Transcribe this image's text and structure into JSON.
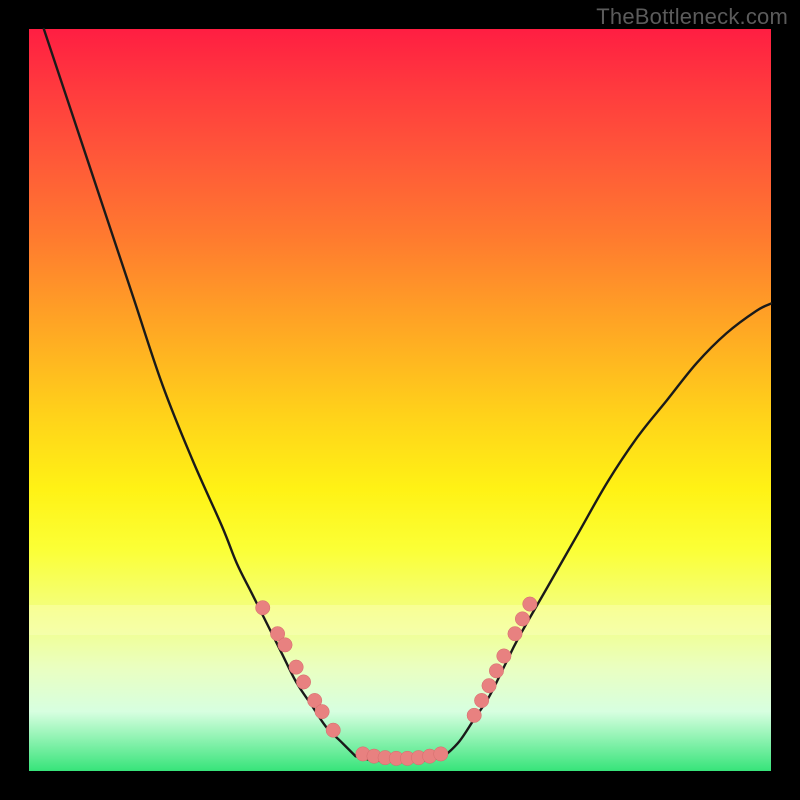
{
  "watermark": "TheBottleneck.com",
  "colors": {
    "curve_stroke": "#1a1a1a",
    "marker_fill": "#e88180",
    "marker_stroke": "#d46c6c",
    "background": "#000000"
  },
  "chart_data": {
    "type": "line",
    "title": "",
    "xlabel": "",
    "ylabel": "",
    "xlim": [
      0,
      100
    ],
    "ylim": [
      0,
      100
    ],
    "grid": false,
    "series": [
      {
        "name": "left-curve",
        "x": [
          2,
          6,
          10,
          14,
          18,
          22,
          26,
          28,
          30,
          32,
          34,
          36,
          38,
          40,
          42,
          44
        ],
        "values": [
          100,
          88,
          76,
          64,
          52,
          42,
          33,
          28,
          24,
          20,
          16,
          12,
          9,
          6,
          4,
          2
        ]
      },
      {
        "name": "flat-min",
        "x": [
          44,
          46,
          48,
          50,
          52,
          54,
          56
        ],
        "values": [
          2,
          1.5,
          1.3,
          1.2,
          1.3,
          1.5,
          2
        ]
      },
      {
        "name": "right-curve",
        "x": [
          56,
          58,
          60,
          62,
          64,
          66,
          70,
          74,
          78,
          82,
          86,
          90,
          94,
          98,
          100
        ],
        "values": [
          2,
          4,
          7,
          10,
          14,
          18,
          25,
          32,
          39,
          45,
          50,
          55,
          59,
          62,
          63
        ]
      }
    ],
    "markers": [
      {
        "x": 31.5,
        "y": 22
      },
      {
        "x": 33.5,
        "y": 18.5
      },
      {
        "x": 34.5,
        "y": 17
      },
      {
        "x": 36,
        "y": 14
      },
      {
        "x": 37,
        "y": 12
      },
      {
        "x": 38.5,
        "y": 9.5
      },
      {
        "x": 39.5,
        "y": 8
      },
      {
        "x": 41,
        "y": 5.5
      },
      {
        "x": 45,
        "y": 2.3
      },
      {
        "x": 46.5,
        "y": 2.0
      },
      {
        "x": 48,
        "y": 1.8
      },
      {
        "x": 49.5,
        "y": 1.7
      },
      {
        "x": 51,
        "y": 1.7
      },
      {
        "x": 52.5,
        "y": 1.8
      },
      {
        "x": 54,
        "y": 2.0
      },
      {
        "x": 55.5,
        "y": 2.3
      },
      {
        "x": 60,
        "y": 7.5
      },
      {
        "x": 61,
        "y": 9.5
      },
      {
        "x": 62,
        "y": 11.5
      },
      {
        "x": 63,
        "y": 13.5
      },
      {
        "x": 64,
        "y": 15.5
      },
      {
        "x": 65.5,
        "y": 18.5
      },
      {
        "x": 66.5,
        "y": 20.5
      },
      {
        "x": 67.5,
        "y": 22.5
      }
    ]
  }
}
